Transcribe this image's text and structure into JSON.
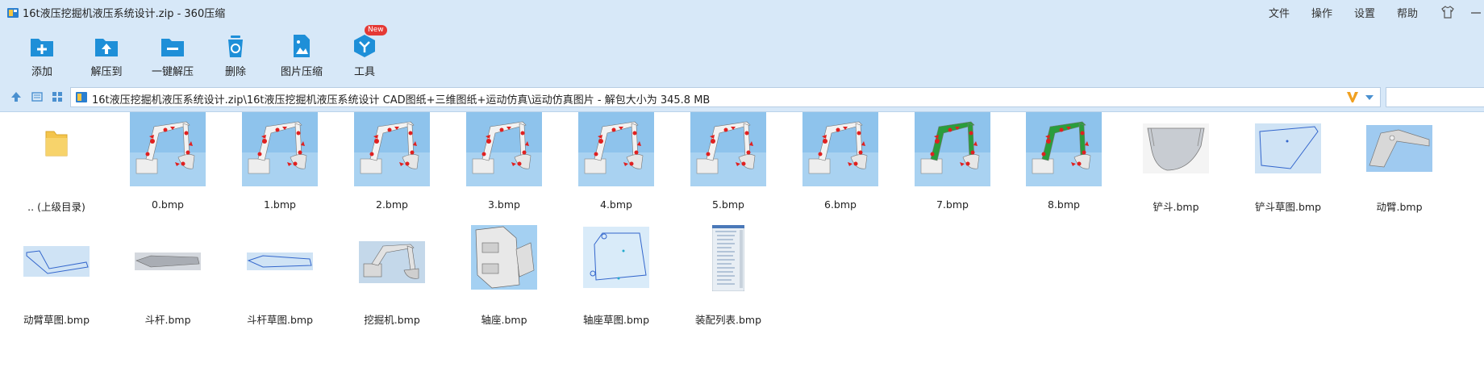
{
  "window": {
    "title": "16t液压挖掘机液压系统设计.zip - 360压缩",
    "menu": [
      "文件",
      "操作",
      "设置",
      "帮助"
    ]
  },
  "toolbar": {
    "items": [
      {
        "label": "添加",
        "icon": "add-icon"
      },
      {
        "label": "解压到",
        "icon": "extract-to-icon"
      },
      {
        "label": "一键解压",
        "icon": "one-click-extract-icon"
      },
      {
        "label": "删除",
        "icon": "delete-icon"
      },
      {
        "label": "图片压缩",
        "icon": "image-compress-icon"
      },
      {
        "label": "工具",
        "icon": "tools-icon"
      }
    ],
    "new_badge": "New"
  },
  "address": {
    "path": "16t液压挖掘机液压系统设计.zip\\16t液压挖掘机液压系统设计 CAD图纸+三维图纸+运动仿真\\运动仿真图片 - 解包大小为 345.8 MB"
  },
  "files": [
    {
      "name": ".. (上级目录)",
      "kind": "folder"
    },
    {
      "name": "0.bmp",
      "kind": "sim"
    },
    {
      "name": "1.bmp",
      "kind": "sim"
    },
    {
      "name": "2.bmp",
      "kind": "sim"
    },
    {
      "name": "3.bmp",
      "kind": "sim"
    },
    {
      "name": "4.bmp",
      "kind": "sim"
    },
    {
      "name": "5.bmp",
      "kind": "sim"
    },
    {
      "name": "6.bmp",
      "kind": "sim"
    },
    {
      "name": "7.bmp",
      "kind": "sim-green"
    },
    {
      "name": "8.bmp",
      "kind": "sim-green"
    },
    {
      "name": "铲斗.bmp",
      "kind": "bucket"
    },
    {
      "name": "铲斗草图.bmp",
      "kind": "sketch-bucket"
    },
    {
      "name": "动臂.bmp",
      "kind": "boom"
    },
    {
      "name": "动臂草图.bmp",
      "kind": "sketch-boom"
    },
    {
      "name": "斗杆.bmp",
      "kind": "arm"
    },
    {
      "name": "斗杆草图.bmp",
      "kind": "sketch-arm"
    },
    {
      "name": "挖掘机.bmp",
      "kind": "excavator"
    },
    {
      "name": "轴座.bmp",
      "kind": "seat"
    },
    {
      "name": "轴座草图.bmp",
      "kind": "sketch-seat"
    },
    {
      "name": "装配列表.bmp",
      "kind": "list"
    }
  ],
  "colors": {
    "topbar_bg": "#d7e8f8",
    "accent": "#1e8fd8",
    "badge": "#e53935"
  }
}
